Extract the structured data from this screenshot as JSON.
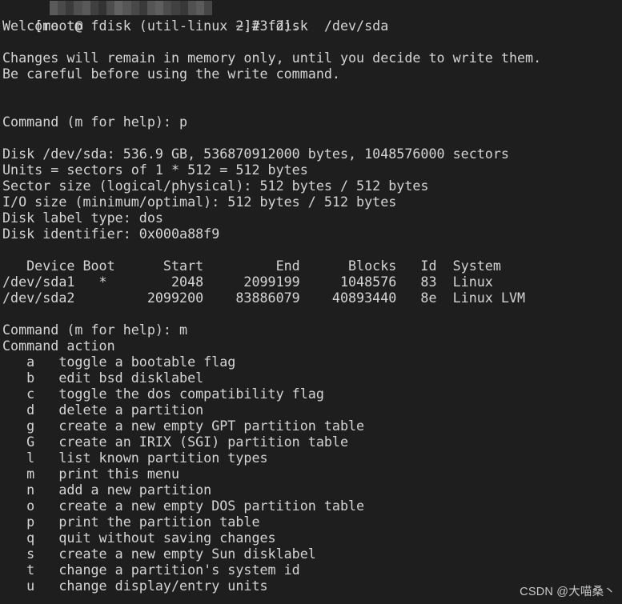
{
  "terminal": {
    "background_color": "#1e1e1e",
    "foreground_color": "#d4d4d4",
    "font_size_px": 16.7,
    "line_height_px": 20,
    "prompt": {
      "prefix": "[root@",
      "hostname_redacted": true,
      "suffix": " ~]# ",
      "command": "fdisk  /dev/sda",
      "full_line_visible_text": "[root@                   ~]# fdisk  /dev/sda",
      "redaction_color_blocks": [
        "#5a5a5a",
        "#4a4a4a",
        "#3b3b3b",
        "#4f4f4f",
        "#595959",
        "#404040",
        "#333333",
        "#4d4d4d",
        "#626262",
        "#565656",
        "#484848",
        "#3a3a3a",
        "#555555",
        "#5e5e5e",
        "#4c4c4c",
        "#414141",
        "#383838",
        "#505050",
        "#5b5b5b",
        "#464646"
      ]
    },
    "lines": [
      {
        "id": "line-prompt",
        "text": "[root@                   ~]# fdisk  /dev/sda"
      },
      {
        "id": "line-welcome",
        "text": "Welcome to fdisk (util-linux 2.23.2)."
      },
      {
        "id": "line-blank-1",
        "text": ""
      },
      {
        "id": "line-warn-1",
        "text": "Changes will remain in memory only, until you decide to write them."
      },
      {
        "id": "line-warn-2",
        "text": "Be careful before using the write command."
      },
      {
        "id": "line-blank-2",
        "text": ""
      },
      {
        "id": "line-blank-3",
        "text": ""
      },
      {
        "id": "line-command-p",
        "text": "Command (m for help): p"
      },
      {
        "id": "line-blank-4",
        "text": ""
      },
      {
        "id": "line-disk-size",
        "text": "Disk /dev/sda: 536.9 GB, 536870912000 bytes, 1048576000 sectors"
      },
      {
        "id": "line-units",
        "text": "Units = sectors of 1 * 512 = 512 bytes"
      },
      {
        "id": "line-sector-size",
        "text": "Sector size (logical/physical): 512 bytes / 512 bytes"
      },
      {
        "id": "line-io-size",
        "text": "I/O size (minimum/optimal): 512 bytes / 512 bytes"
      },
      {
        "id": "line-label-type",
        "text": "Disk label type: dos"
      },
      {
        "id": "line-identifier",
        "text": "Disk identifier: 0x000a88f9"
      },
      {
        "id": "line-blank-5",
        "text": ""
      },
      {
        "id": "line-table-header",
        "text": "   Device Boot      Start         End      Blocks   Id  System"
      },
      {
        "id": "line-table-row-1",
        "text": "/dev/sda1   *        2048     2099199     1048576   83  Linux"
      },
      {
        "id": "line-table-row-2",
        "text": "/dev/sda2         2099200    83886079    40893440   8e  Linux LVM"
      },
      {
        "id": "line-blank-6",
        "text": ""
      },
      {
        "id": "line-command-m",
        "text": "Command (m for help): m"
      },
      {
        "id": "line-command-action",
        "text": "Command action"
      },
      {
        "id": "line-menu-a",
        "text": "   a   toggle a bootable flag"
      },
      {
        "id": "line-menu-b",
        "text": "   b   edit bsd disklabel"
      },
      {
        "id": "line-menu-c",
        "text": "   c   toggle the dos compatibility flag"
      },
      {
        "id": "line-menu-d",
        "text": "   d   delete a partition"
      },
      {
        "id": "line-menu-g",
        "text": "   g   create a new empty GPT partition table"
      },
      {
        "id": "line-menu-G",
        "text": "   G   create an IRIX (SGI) partition table"
      },
      {
        "id": "line-menu-l",
        "text": "   l   list known partition types"
      },
      {
        "id": "line-menu-m",
        "text": "   m   print this menu"
      },
      {
        "id": "line-menu-n",
        "text": "   n   add a new partition"
      },
      {
        "id": "line-menu-o",
        "text": "   o   create a new empty DOS partition table"
      },
      {
        "id": "line-menu-p",
        "text": "   p   print the partition table"
      },
      {
        "id": "line-menu-q",
        "text": "   q   quit without saving changes"
      },
      {
        "id": "line-menu-s",
        "text": "   s   create a new empty Sun disklabel"
      },
      {
        "id": "line-menu-t",
        "text": "   t   change a partition's system id"
      },
      {
        "id": "line-menu-u",
        "text": "   u   change display/entry units"
      }
    ],
    "partition_table": {
      "columns": [
        "Device",
        "Boot",
        "Start",
        "End",
        "Blocks",
        "Id",
        "System"
      ],
      "rows": [
        {
          "device": "/dev/sda1",
          "boot": "*",
          "start": "2048",
          "end": "2099199",
          "blocks": "1048576",
          "id": "83",
          "system": "Linux"
        },
        {
          "device": "/dev/sda2",
          "boot": "",
          "start": "2099200",
          "end": "83886079",
          "blocks": "40893440",
          "id": "8e",
          "system": "Linux LVM"
        }
      ]
    },
    "disk_info": {
      "device": "/dev/sda",
      "size_human": "536.9 GB",
      "size_bytes": "536870912000",
      "sectors": "1048576000",
      "units": "sectors of 1 * 512 = 512 bytes",
      "sector_size_logical": "512 bytes",
      "sector_size_physical": "512 bytes",
      "io_size_minimum": "512 bytes",
      "io_size_optimal": "512 bytes",
      "label_type": "dos",
      "identifier": "0x000a88f9"
    },
    "command_menu": [
      {
        "key": "a",
        "description": "toggle a bootable flag"
      },
      {
        "key": "b",
        "description": "edit bsd disklabel"
      },
      {
        "key": "c",
        "description": "toggle the dos compatibility flag"
      },
      {
        "key": "d",
        "description": "delete a partition"
      },
      {
        "key": "g",
        "description": "create a new empty GPT partition table"
      },
      {
        "key": "G",
        "description": "create an IRIX (SGI) partition table"
      },
      {
        "key": "l",
        "description": "list known partition types"
      },
      {
        "key": "m",
        "description": "print this menu"
      },
      {
        "key": "n",
        "description": "add a new partition"
      },
      {
        "key": "o",
        "description": "create a new empty DOS partition table"
      },
      {
        "key": "p",
        "description": "print the partition table"
      },
      {
        "key": "q",
        "description": "quit without saving changes"
      },
      {
        "key": "s",
        "description": "create a new empty Sun disklabel"
      },
      {
        "key": "t",
        "description": "change a partition's system id"
      },
      {
        "key": "u",
        "description": "change display/entry units"
      }
    ]
  },
  "watermark": {
    "text": "CSDN @大喵桑丶",
    "color": "#c9c9c9"
  }
}
